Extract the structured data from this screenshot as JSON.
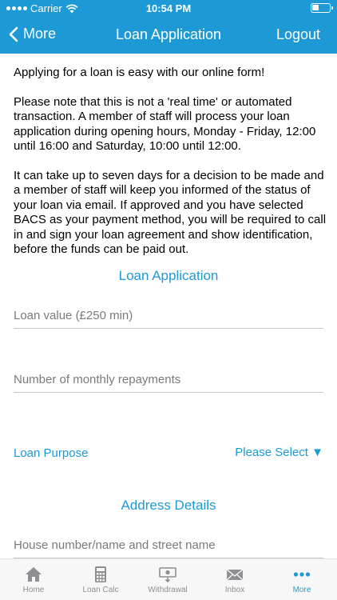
{
  "status_bar": {
    "carrier": "Carrier",
    "time": "10:54 PM"
  },
  "nav": {
    "back_label": "More",
    "title": "Loan Application",
    "logout_label": "Logout"
  },
  "intro": [
    "Applying for a loan is easy with our online form!",
    "Please note that this is not a 'real time' or automated transaction. A member of staff will process your loan application during opening hours, Monday - Friday, 12:00 until 16:00 and Saturday, 10:00 until 12:00.",
    "It can take up to seven days for a decision to be made and a member of staff will keep you informed of the status of your loan via email. If approved and you have selected BACS as your payment method, you will be required to call in and sign your loan agreement and show identification, before the funds can be paid out."
  ],
  "form": {
    "section_title": "Loan Application",
    "loan_value": {
      "placeholder": "Loan value (£250 min)",
      "value": ""
    },
    "repayments": {
      "placeholder": "Number of monthly repayments",
      "value": ""
    },
    "purpose": {
      "label": "Loan Purpose",
      "selected": "Please Select ▼"
    },
    "address_title": "Address Details",
    "street": {
      "placeholder": "House number/name and street name",
      "value": ""
    }
  },
  "tabs": [
    {
      "label": "Home",
      "icon": "home-icon"
    },
    {
      "label": "Loan Calc",
      "icon": "calculator-icon"
    },
    {
      "label": "Withdrawal",
      "icon": "withdrawal-icon"
    },
    {
      "label": "Inbox",
      "icon": "envelope-icon"
    },
    {
      "label": "More",
      "icon": "more-dots-icon"
    }
  ],
  "colors": {
    "accent": "#1d9ad6",
    "tab_inactive": "#8e8e93"
  }
}
